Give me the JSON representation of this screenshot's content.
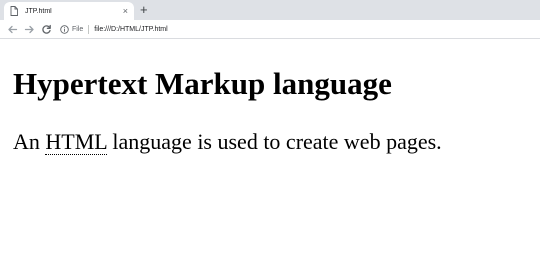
{
  "browser": {
    "tab": {
      "title": "JTP.html",
      "close_glyph": "×",
      "icon": "document-icon"
    },
    "new_tab_glyph": "+",
    "nav": {
      "back_icon": "back-arrow-icon",
      "forward_icon": "forward-arrow-icon",
      "reload_icon": "reload-icon"
    },
    "omnibox": {
      "info_icon": "info-icon",
      "site_label": "File",
      "url": "file:///D:/HTML/JTP.html"
    }
  },
  "page": {
    "heading": "Hypertext Markup language",
    "paragraph": {
      "before": "An ",
      "abbr": "HTML",
      "after": " language is used to create web pages."
    }
  }
}
